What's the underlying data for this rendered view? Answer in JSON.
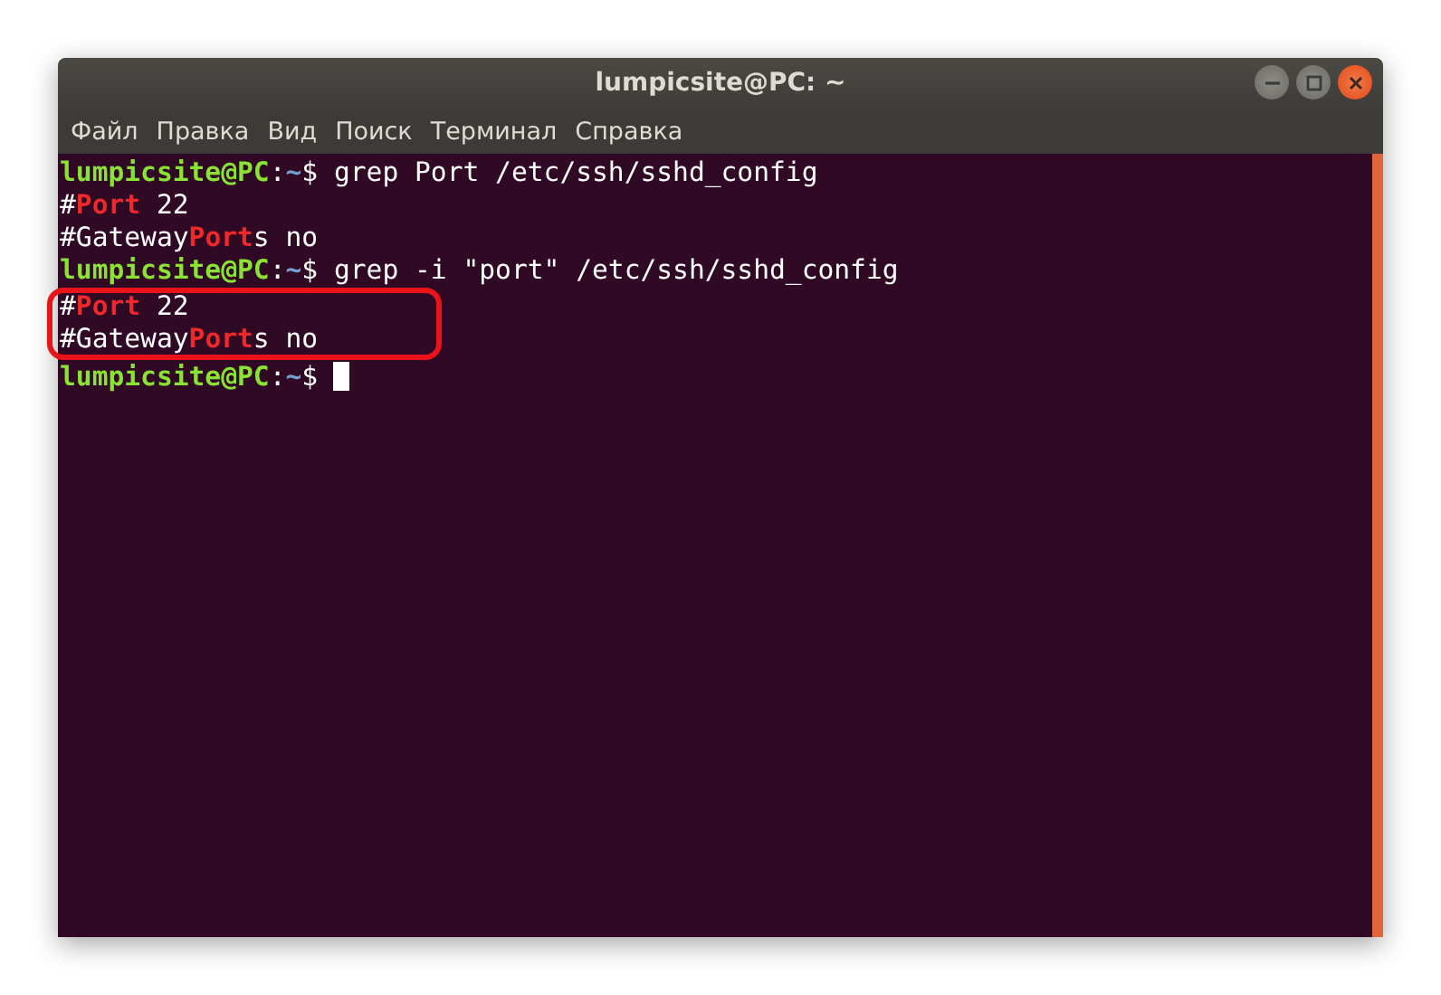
{
  "window": {
    "title": "lumpicsite@PC: ~"
  },
  "menu": [
    "Файл",
    "Правка",
    "Вид",
    "Поиск",
    "Терминал",
    "Справка"
  ],
  "terminal": {
    "lines": [
      {
        "highlighted": false,
        "cursor": false,
        "segments": [
          {
            "kind": "user",
            "text": "lumpicsite@PC"
          },
          {
            "kind": "plain",
            "text": ":"
          },
          {
            "kind": "path",
            "text": "~"
          },
          {
            "kind": "plain",
            "text": "$ grep Port /etc/ssh/sshd_config"
          }
        ]
      },
      {
        "highlighted": false,
        "cursor": false,
        "segments": [
          {
            "kind": "plain",
            "text": "#"
          },
          {
            "kind": "match",
            "text": "Port"
          },
          {
            "kind": "plain",
            "text": " 22"
          }
        ]
      },
      {
        "highlighted": false,
        "cursor": false,
        "segments": [
          {
            "kind": "plain",
            "text": "#Gateway"
          },
          {
            "kind": "match",
            "text": "Port"
          },
          {
            "kind": "plain",
            "text": "s no"
          }
        ]
      },
      {
        "highlighted": false,
        "cursor": false,
        "segments": [
          {
            "kind": "user",
            "text": "lumpicsite@PC"
          },
          {
            "kind": "plain",
            "text": ":"
          },
          {
            "kind": "path",
            "text": "~"
          },
          {
            "kind": "plain",
            "text": "$ grep -i \"port\" /etc/ssh/sshd_config"
          }
        ]
      },
      {
        "highlighted": true,
        "cursor": false,
        "segments": [
          {
            "kind": "plain",
            "text": "#"
          },
          {
            "kind": "match",
            "text": "Port"
          },
          {
            "kind": "plain",
            "text": " 22"
          }
        ]
      },
      {
        "highlighted": true,
        "cursor": false,
        "segments": [
          {
            "kind": "plain",
            "text": "#Gateway"
          },
          {
            "kind": "match",
            "text": "Port"
          },
          {
            "kind": "plain",
            "text": "s no"
          }
        ]
      },
      {
        "highlighted": false,
        "cursor": true,
        "segments": [
          {
            "kind": "user",
            "text": "lumpicsite@PC"
          },
          {
            "kind": "plain",
            "text": ":"
          },
          {
            "kind": "path",
            "text": "~"
          },
          {
            "kind": "plain",
            "text": "$ "
          }
        ]
      }
    ]
  }
}
